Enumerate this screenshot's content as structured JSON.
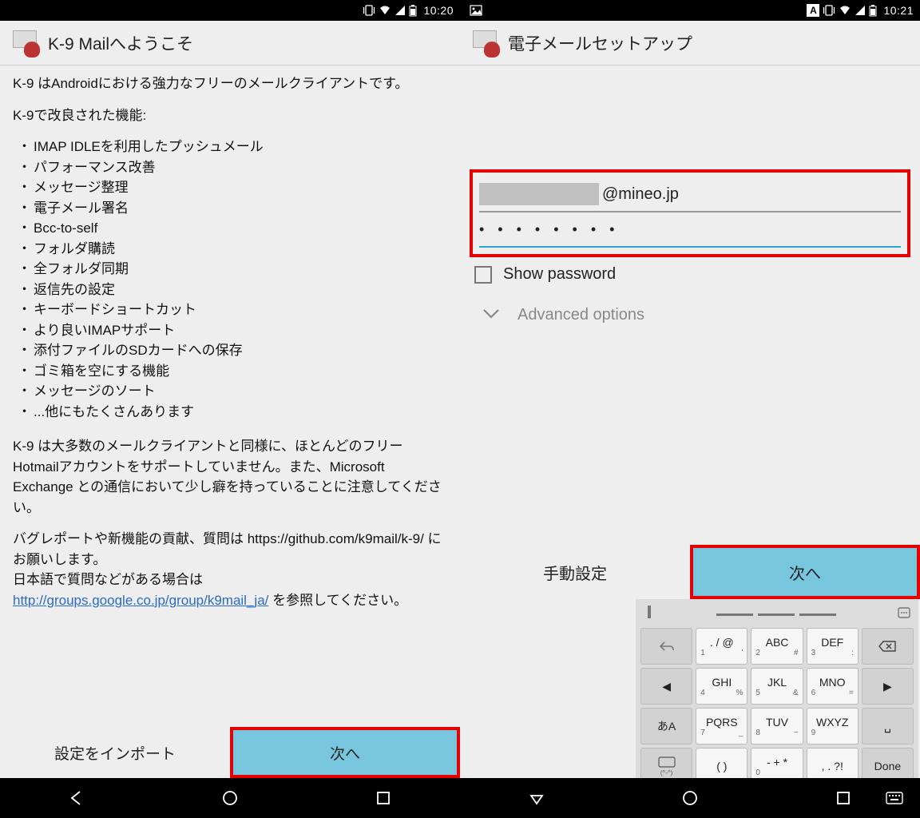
{
  "left": {
    "statusbar": {
      "time": "10:20"
    },
    "appbar": {
      "title": "K-9 Mailへようこそ"
    },
    "intro": "K-9 はAndroidにおける強力なフリーのメールクライアントです。",
    "features_heading": "K-9で改良された機能:",
    "features": [
      "IMAP IDLEを利用したプッシュメール",
      "パフォーマンス改善",
      "メッセージ整理",
      "電子メール署名",
      "Bcc-to-self",
      "フォルダ購読",
      "全フォルダ同期",
      "返信先の設定",
      "キーボードショートカット",
      "より良いIMAPサポート",
      "添付ファイルのSDカードへの保存",
      "ゴミ箱を空にする機能",
      "メッセージのソート",
      "...他にもたくさんあります"
    ],
    "note1": "K-9 は大多数のメールクライアントと同様に、ほとんどのフリーHotmailアカウントをサポートしていません。また、Microsoft Exchange との通信において少し癖を持っていることに注意してください。",
    "note2_pre": "バグレポートや新機能の貢献、質問は https://github.com/k9mail/k-9/ にお願いします。\n日本語で質問などがある場合は ",
    "note2_link": "http://groups.google.co.jp/group/k9mail_ja/",
    "note2_post": " を参照してください。",
    "buttons": {
      "import": "設定をインポート",
      "next": "次へ"
    }
  },
  "right": {
    "statusbar": {
      "ime": "A",
      "time": "10:21"
    },
    "appbar": {
      "title": "電子メールセットアップ"
    },
    "email_domain": "@mineo.jp",
    "password_mask": "• • • • • • • •",
    "show_password": "Show password",
    "advanced": "Advanced options",
    "buttons": {
      "manual": "手動設定",
      "next": "次へ"
    },
    "keyboard": {
      "rows": [
        [
          {
            "main": "",
            "icon": "undo",
            "gray": true
          },
          {
            "main": ". / @",
            "sub": [
              "1",
              "'"
            ]
          },
          {
            "main": "ABC",
            "sub": [
              "2",
              "#"
            ]
          },
          {
            "main": "DEF",
            "sub": [
              "3",
              ":"
            ]
          },
          {
            "main": "",
            "icon": "backspace",
            "gray": true
          }
        ],
        [
          {
            "main": "◀",
            "gray": true
          },
          {
            "main": "GHI",
            "sub": [
              "4",
              "%"
            ]
          },
          {
            "main": "JKL",
            "sub": [
              "5",
              "&"
            ]
          },
          {
            "main": "MNO",
            "sub": [
              "6",
              "="
            ]
          },
          {
            "main": "▶",
            "gray": true
          }
        ],
        [
          {
            "main": "あA",
            "gray": true
          },
          {
            "main": "PQRS",
            "sub": [
              "7",
              "_"
            ]
          },
          {
            "main": "TUV",
            "sub": [
              "8",
              "~"
            ]
          },
          {
            "main": "WXYZ",
            "sub": [
              "9",
              ""
            ]
          },
          {
            "main": "␣",
            "gray": true
          }
        ],
        [
          {
            "main": "",
            "icon": "kb",
            "gray": true
          },
          {
            "main": "( )",
            "sub": [
              "",
              ""
            ]
          },
          {
            "main": "- + *",
            "sub": [
              "0",
              ""
            ]
          },
          {
            "main": ", . ?!",
            "sub": [
              "",
              ""
            ]
          },
          {
            "main": "Done",
            "gray": true
          }
        ]
      ]
    }
  }
}
